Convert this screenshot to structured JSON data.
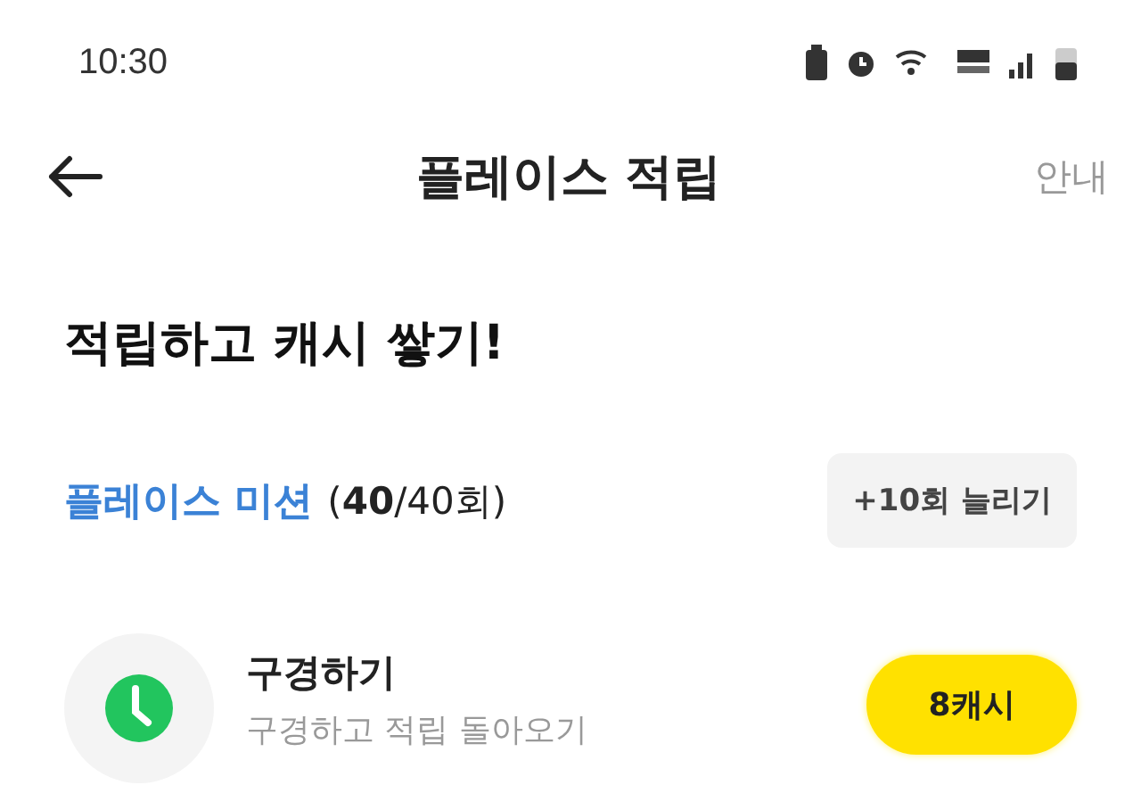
{
  "status_bar": {
    "time": "10:30"
  },
  "header": {
    "title": "플레이스 적립",
    "action": "안내"
  },
  "headline": "적립하고 캐시 쌓기!",
  "mission": {
    "title": "플레이스 미션",
    "count": "(**40**/40회)",
    "button": "+10회 늘리기"
  },
  "tasks": [
    {
      "title": "구경하기",
      "subtitle": "구경하고 적립 돌아오기",
      "reward": "8캐시"
    }
  ]
}
